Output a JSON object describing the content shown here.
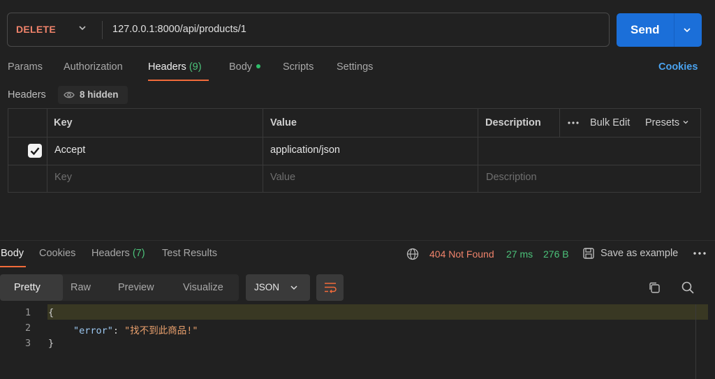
{
  "request": {
    "method": "DELETE",
    "url": "127.0.0.1:8000/api/products/1",
    "send_label": "Send"
  },
  "request_tabs": {
    "params": "Params",
    "authorization": "Authorization",
    "headers": "Headers",
    "headers_count": "(9)",
    "body": "Body",
    "scripts": "Scripts",
    "settings": "Settings",
    "cookies": "Cookies"
  },
  "headers_section": {
    "label": "Headers",
    "hidden_text": "8 hidden",
    "columns": {
      "key": "Key",
      "value": "Value",
      "description": "Description"
    },
    "tools": {
      "bulk_edit": "Bulk Edit",
      "presets": "Presets"
    },
    "rows": [
      {
        "checked": true,
        "key": "Accept",
        "value": "application/json",
        "description": ""
      }
    ],
    "placeholders": {
      "key": "Key",
      "value": "Value",
      "description": "Description"
    }
  },
  "response_tabs": {
    "body": "Body",
    "cookies": "Cookies",
    "headers": "Headers",
    "headers_count": "(7)",
    "test_results": "Test Results"
  },
  "response_status": {
    "status": "404 Not Found",
    "time": "27 ms",
    "size": "276 B",
    "save_example": "Save as example"
  },
  "view_modes": {
    "pretty": "Pretty",
    "raw": "Raw",
    "preview": "Preview",
    "visualize": "Visualize",
    "format": "JSON"
  },
  "code": {
    "line_numbers": [
      "1",
      "2",
      "3"
    ],
    "open_brace": "{",
    "key": "\"error\"",
    "colon": ": ",
    "value": "\"找不到此商品!\"",
    "close_brace": "}"
  },
  "colors": {
    "accent": "#f26b3a",
    "send": "#1b6fd9",
    "status_error": "#f0836b",
    "status_ok": "#4cc27a",
    "link": "#4aa3f0"
  }
}
